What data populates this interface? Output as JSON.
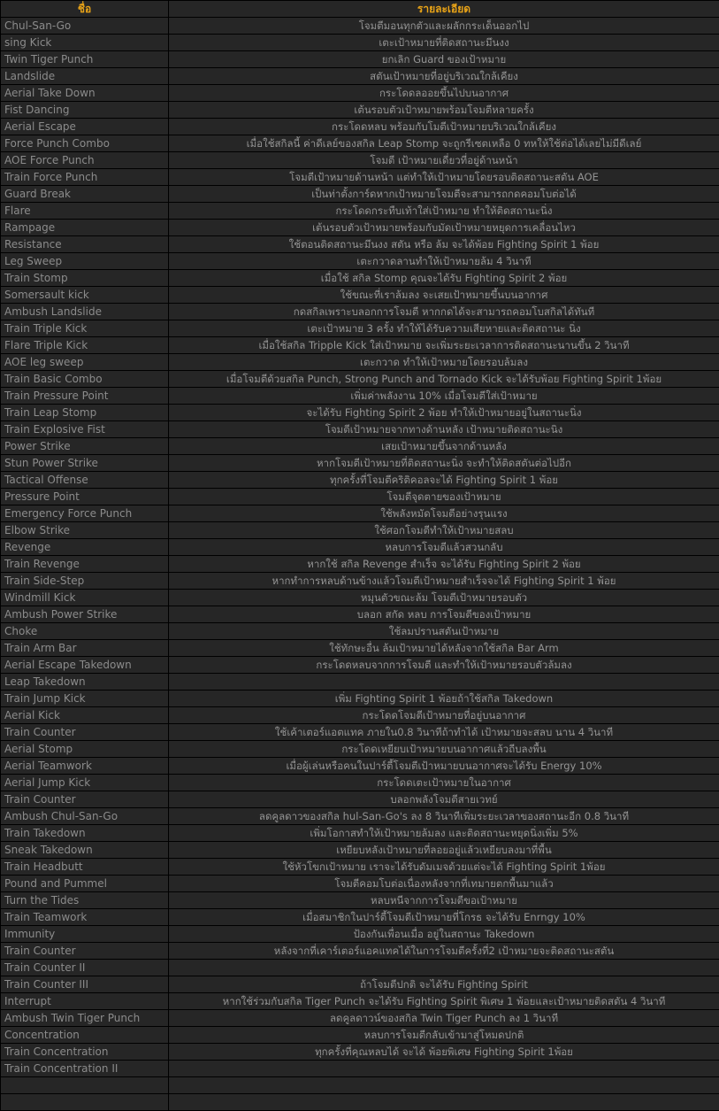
{
  "table": {
    "columns": [
      {
        "key": "name",
        "label": "ชื่อ"
      },
      {
        "key": "detail",
        "label": "รายละเอียด"
      }
    ],
    "colors": {
      "header_text": "#e8a317",
      "name_text": "#8b8b8b",
      "detail_text": "#949494",
      "cell_background": "#262626",
      "border": "#000000"
    },
    "rows": [
      {
        "name": "Chul-San-Go",
        "detail": "โจมตีมอนทุกตัวและผลักกระเด็นออกไป"
      },
      {
        "name": "sing Kick",
        "detail": "เตะเป้าหมายที่ติดสถานะมึนงง"
      },
      {
        "name": "Twin Tiger Punch",
        "detail": "ยกเลิก Guard ของเป้าหมาย"
      },
      {
        "name": "Landslide",
        "detail": "สตันเป้าหมายที่อยู่บริเวณใกล้เคียง"
      },
      {
        "name": "Aerial Take Down",
        "detail": "กระโดดลออยขึ้นไปบนอากาศ"
      },
      {
        "name": "Fist Dancing",
        "detail": "เต้นรอบตัวเป้าหมายพร้อมโจมตีหลายครั้ง"
      },
      {
        "name": "Aerial Escape",
        "detail": "กระโดดหลบ พร้อมกับโมตีเป้าหมายบริเวณใกล้เคียง"
      },
      {
        "name": "Force Punch Combo",
        "detail": "เมื่อใช้สกิลนี้ ค่าดีเลย์ของสกิล Leap Stomp จะถูกรีเซตเหลือ 0 ทหให้ใช้ต่อได้เลยไม่มีดีเลย์"
      },
      {
        "name": "AOE Force Punch",
        "detail": "โจมตี เป้าหมายเดี่ยวที่อยู่ด้านหน้า"
      },
      {
        "name": "Train Force Punch",
        "detail": "โจมตีเป้าหมายด้านหน้า แต่ทำให้เป้าหมายโดยรอบติดสถานะสตัน AOE"
      },
      {
        "name": "Guard Break",
        "detail": "เป็นท่าตั้งการ์ดหากเป้าหมายโจมตีจะสามารถกดคอมโบต่อได้"
      },
      {
        "name": "Flare",
        "detail": "กระโดดกระทืบเท้าใส่เป้าหมาย ทำให้ติดสถานะนิ่ง"
      },
      {
        "name": "Rampage",
        "detail": "เต้นรอบตัวเป้าหมายพร้อมกับมัดเป้าหมายหยุดการเคลื่อนไหว"
      },
      {
        "name": "Resistance",
        "detail": "ใช้ตอนติดสถานะมึนงง สตัน หรือ ล้ม จะได้พ้อย Fighting Spirit 1 พ้อย"
      },
      {
        "name": "Leg Sweep",
        "detail": "เตะกวาดลานทำให้เป้าหมายล้ม 4 วินาที"
      },
      {
        "name": "Train Stomp",
        "detail": "เมื่อใช้ สกิล Stomp คุณจะได้รับ Fighting Spirit  2 พ้อย"
      },
      {
        "name": "Somersault kick",
        "detail": "ใช้ขณะที่เราล้มลง จะเสยเป้าหมายขึ้นบนอากาศ"
      },
      {
        "name": "Ambush Landslide",
        "detail": "กดสกิลเพราะบลอกการโจมตี หากกดได้จะสามารถคอมโบสกิลได้ทันที"
      },
      {
        "name": "Train Triple Kick",
        "detail": "เตะเป้าหมาย 3 ครั้ง ทำให้ได้รับความเสียหายและติดสถานะ นิ่ง"
      },
      {
        "name": "Flare Triple Kick",
        "detail": "เมื่อใช้สกิล Tripple Kick ใส่เป้าหมาย จะเพิ่มระยะเวลาการติดสถานะนานขึ้น 2 วินาที"
      },
      {
        "name": "AOE leg sweep",
        "detail": "เตะกวาด ทำให้เป้าหมายโดยรอบล้มลง"
      },
      {
        "name": "Train Basic Combo",
        "detail": "เมื่อโจมตีด้วยสกิล Punch, Strong Punch and Tornado Kick จะได้รับพ้อย Fighting Spirit 1พ้อย"
      },
      {
        "name": "Train Pressure Point",
        "detail": "เพิ่มค่าพลังงาน 10% เมื่อโจมตีใส่เป้าหมาย"
      },
      {
        "name": "Train Leap Stomp",
        "detail": "จะได้รับ Fighting Spirit 2 พ้อย ทำให้เป้าหมายอยู่ในสถานะนิ่ง"
      },
      {
        "name": "Train Explosive Fist",
        "detail": "โจมตีเป้าหมายจากทางด้านหลัง เป้าหมายติดสถานะนิง"
      },
      {
        "name": "Power Strike",
        "detail": "เสยเป้าหมายขึ้นจากด้านหลัง"
      },
      {
        "name": "Stun Power Strike",
        "detail": "หากโจมตีเป้าหมายที่ติดสถานะนิ่ง จะทำให้ติดสตันต่อไปอีก"
      },
      {
        "name": "Tactical Offense",
        "detail": "ทุกครั้งที่โจมตีคริติคอลจะได้ Fighting Spirit  1 พ้อย"
      },
      {
        "name": "Pressure Point",
        "detail": "โจมตีจุดตายของเป้าหมาย"
      },
      {
        "name": "Emergency Force Punch",
        "detail": "ใช้พลังหมัดโจมตีอย่างรุนแรง"
      },
      {
        "name": "Elbow Strike",
        "detail": "ใช้ศอกโจมตีทำให้เป้าหมายสลบ"
      },
      {
        "name": "Revenge",
        "detail": "หลบการโจมตีแล้วสวนกลับ"
      },
      {
        "name": "Train Revenge",
        "detail": "หากใช้ สกิล Revenge สำเร็จ จะได้รับ Fighting Spirit 2 พ้อย"
      },
      {
        "name": "Train Side-Step",
        "detail": "หากทำการหลบด้านข้างแล้วโจมตีเป้าหมายสำเร็จจะได้ Fighting Spirit 1 พ้อย"
      },
      {
        "name": "Windmill Kick",
        "detail": "หมุนตัวขณะล้ม โจมตีเป้าหมายรอบตัว"
      },
      {
        "name": "Ambush Power Strike",
        "detail": "บลอก สกัด หลบ การโจมตีของเป้าหมาย"
      },
      {
        "name": "Choke",
        "detail": "ใช้ลมปรานสตันเป้าหมาย"
      },
      {
        "name": "Train Arm Bar",
        "detail": "ใช้ทักษะอื่น ล้มเป้าหมายได้หลังจากใช้สกิล Bar Arm"
      },
      {
        "name": "Aerial Escape Takedown",
        "detail": "กระโดดหลบจากการโจมตี และทำให้เป้าหมายรอบตัวล้มลง"
      },
      {
        "name": "Leap Takedown",
        "detail": ""
      },
      {
        "name": "Train Jump Kick",
        "detail": "เพิ่ม Fighting Spirit 1 พ้อยถ้าใช้สกิล Takedown"
      },
      {
        "name": "Aerial Kick",
        "detail": "กระโดดโจมตีเป้าหมายที่อยู่บนอากาศ"
      },
      {
        "name": "Train Counter",
        "detail": "ใช้เค้าเตอร์แอตแทค ภายใน0.8 วินาทีถ้าทำได้ เป้าหมายจะสลบ นาน 4 วินาที"
      },
      {
        "name": "Aerial Stomp",
        "detail": "กระโดดเหยียบเป้าหมายบนอากาศแล้วถีบลงพื้น"
      },
      {
        "name": "Aerial Teamwork",
        "detail": "เมื่อผู้เล่นหรือคนในปาร์ตี้โจมตีเป้าหมายบนอากาศจะได้รับ Energy 10%"
      },
      {
        "name": "Aerial Jump Kick",
        "detail": "กระโดดเตะเป้าหมายในอากาศ"
      },
      {
        "name": "Train Counter",
        "detail": "บลอกพลังโจมตีสายเวทย์"
      },
      {
        "name": "Ambush Chul-San-Go",
        "detail": "ลดคูลดาวของสกิล hul-San-Go's ลง 8 วินาทีเพิ่มระยะเวลาของสถานะอีก  0.8 วินาที"
      },
      {
        "name": "Train Takedown",
        "detail": "เพิ่มโอกาสทำให้เป้าหมายล้มลง และติดสถานะหยุดนิ่งเพิ่ม 5%"
      },
      {
        "name": "Sneak Takedown",
        "detail": "เหยียบหลังเป้าหมายที่ลอยอยู่แล้วเหยียบลงมาที่พื้น"
      },
      {
        "name": "Train Headbutt",
        "detail": "ใช้หัวโขกเป้าหมาย เราจะได้รับดัมเมจด้วยแต่จะได้ Fighting Spirit 1พ้อย"
      },
      {
        "name": "Pound and Pummel",
        "detail": "โจมตีคอมโบต่อเนื่องหลังจากที่เทมายตกพื้นมาแล้ว"
      },
      {
        "name": "Turn the Tides",
        "detail": "หลบหนีจากการโจมตีขอเป้าหมาย"
      },
      {
        "name": "Train Teamwork",
        "detail": "เมื่อสมาชิกในปาร์ตี้โจมตีเป้าหมายที่โกรธ จะได้รับ Enrngy 10%"
      },
      {
        "name": "Immunity",
        "detail": "ป้องกันเพื่อนเมื่อ อยู่ในสถานะ Takedown"
      },
      {
        "name": "Train Counter",
        "detail": "หลังจากที่เคาร์เตอร์แอคแทคได้ในการโจมตีครั้งที่2 เป้าหมายจะติดสถานะสตัน"
      },
      {
        "name": "Train Counter II",
        "detail": ""
      },
      {
        "name": "Train Counter III",
        "detail": "ถ้าโจมตีปกติ จะได้รับ Fighting Spirit"
      },
      {
        "name": "Interrupt",
        "detail": "หากใช้ร่วมกับสกิล Tiger Punch  จะได้รับ Fighting Spirit พิเศษ 1 พ้อยและเป้าหมายติดสตัน 4 วินาที"
      },
      {
        "name": "Ambush Twin Tiger Punch",
        "detail": "ลดคูลดาวน์ของสกิล Twin Tiger Punch ลง 1 วินาที"
      },
      {
        "name": "Concentration",
        "detail": "หลบการโจมตีกลับเข้ามาสู่โหมดปกติ"
      },
      {
        "name": "Train Concentration",
        "detail": "ทุกครั้งที่คุณหลบได้ จะได้ พ้อยพิเศษ Fighting Spirit  1พ้อย"
      },
      {
        "name": "Train Concentration II",
        "detail": ""
      },
      {
        "name": "",
        "detail": ""
      },
      {
        "name": "",
        "detail": ""
      }
    ]
  }
}
